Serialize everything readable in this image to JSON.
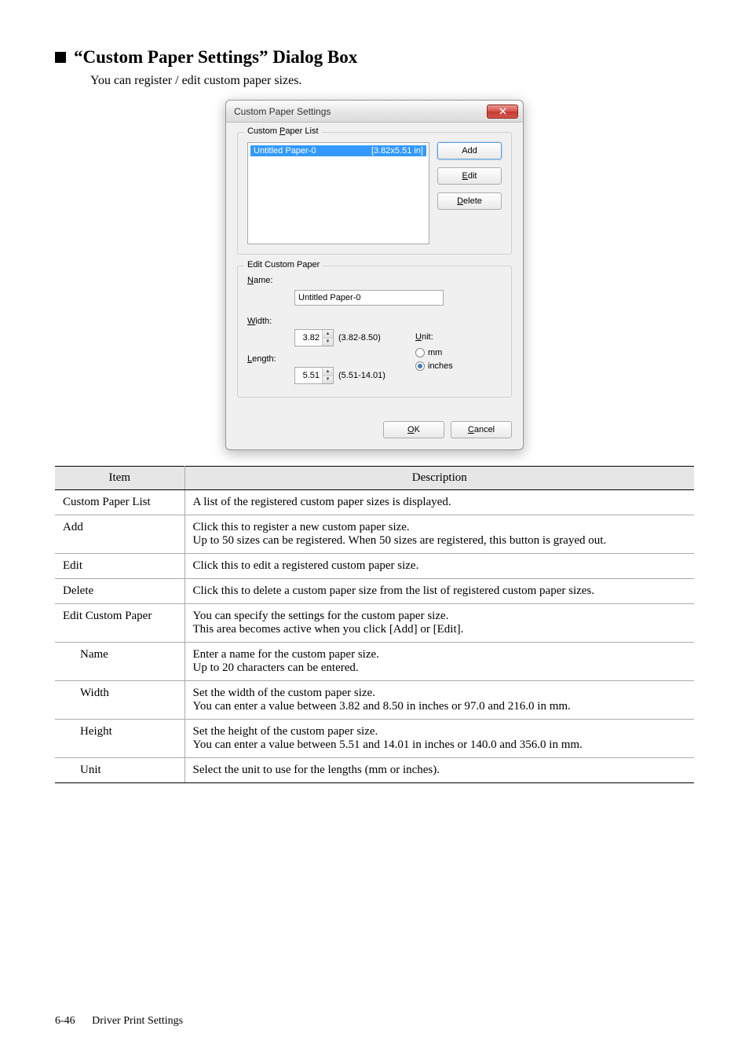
{
  "heading": "“Custom Paper Settings” Dialog Box",
  "intro": "You can register / edit custom paper sizes.",
  "dialog": {
    "title": "Custom Paper Settings",
    "close": "x",
    "group_list_title_pre": "Custom ",
    "group_list_title_u": "P",
    "group_list_title_post": "aper List",
    "list_item_name": "Untitled Paper-0",
    "list_item_size": "[3.82x5.51 in]",
    "btn_add": "Add",
    "btn_edit_u": "E",
    "btn_edit_post": "dit",
    "btn_delete_u": "D",
    "btn_delete_post": "elete",
    "group_edit_title": "Edit Custom Paper",
    "label_name_u": "N",
    "label_name_post": "ame:",
    "name_value": "Untitled Paper-0",
    "label_width_u": "W",
    "label_width_post": "idth:",
    "width_value": "3.82",
    "width_range": "(3.82-8.50)",
    "label_length_u": "L",
    "label_length_post": "ength:",
    "length_value": "5.51",
    "length_range": "(5.51-14.01)",
    "label_unit_u": "U",
    "label_unit_post": "nit:",
    "radio_mm": "mm",
    "radio_inches": "inches",
    "btn_ok_u": "O",
    "btn_ok_post": "K",
    "btn_cancel_u": "C",
    "btn_cancel_post": "ancel"
  },
  "table": {
    "header_item": "Item",
    "header_desc": "Description",
    "rows": [
      {
        "item": "Custom Paper List",
        "desc": "A list of the registered custom paper sizes is displayed."
      },
      {
        "item": "Add",
        "desc": "Click this to register a new custom paper size.\nUp to 50 sizes can be registered. When 50 sizes are registered, this button is grayed out."
      },
      {
        "item": "Edit",
        "desc": "Click this to edit a registered custom paper size."
      },
      {
        "item": "Delete",
        "desc": "Click this to delete a custom paper size from the list of registered custom paper sizes."
      },
      {
        "item": "Edit Custom Paper",
        "desc": "You can specify the settings for the custom paper size.\nThis area becomes active when you click [Add] or [Edit]."
      },
      {
        "item": "Name",
        "sub": true,
        "desc": "Enter a name for the custom paper size.\nUp to 20 characters can be entered."
      },
      {
        "item": "Width",
        "sub": true,
        "desc": "Set the width of the custom paper size.\nYou can enter a value between 3.82 and 8.50 in inches or 97.0 and 216.0 in mm."
      },
      {
        "item": "Height",
        "sub": true,
        "desc": "Set the height of the custom paper size.\nYou can enter a value between 5.51 and 14.01 in inches or 140.0 and 356.0 in mm."
      },
      {
        "item": "Unit",
        "sub": true,
        "desc": "Select the unit to use for the lengths (mm or inches)."
      }
    ]
  },
  "footer": {
    "page": "6-46",
    "section": "Driver Print Settings"
  }
}
